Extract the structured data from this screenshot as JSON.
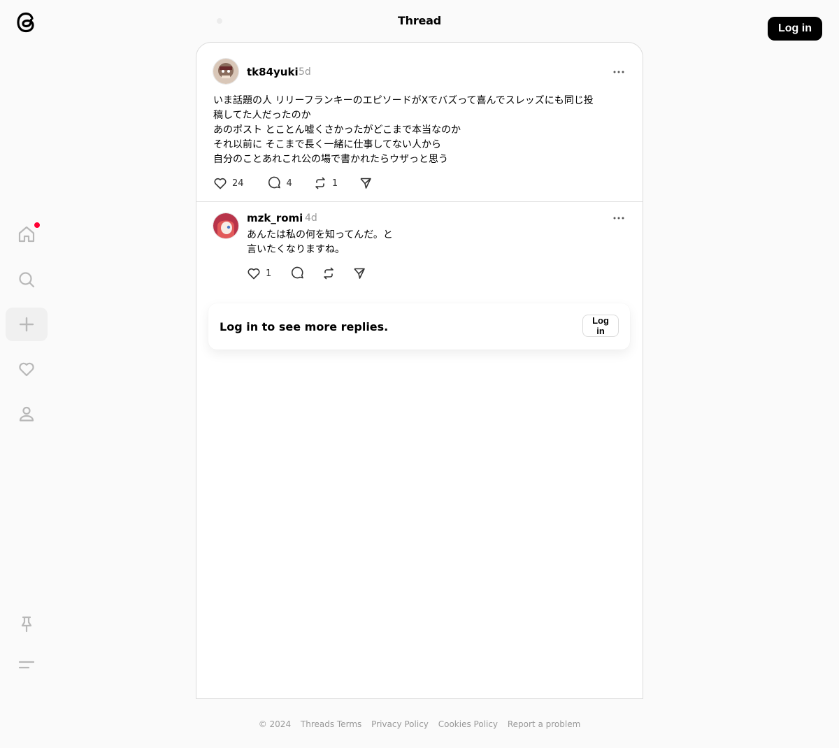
{
  "header": {
    "title": "Thread",
    "login_label": "Log in"
  },
  "sidebar": {
    "items": [
      {
        "name": "home",
        "icon": "home-icon",
        "notification": true
      },
      {
        "name": "search",
        "icon": "search-icon"
      },
      {
        "name": "create",
        "icon": "plus-icon",
        "active": true
      },
      {
        "name": "activity",
        "icon": "heart-icon"
      },
      {
        "name": "profile",
        "icon": "person-icon"
      }
    ],
    "bottom_items": [
      {
        "name": "pinned",
        "icon": "pin-icon"
      },
      {
        "name": "more",
        "icon": "menu-icon"
      }
    ]
  },
  "posts": [
    {
      "username": "tk84yuki",
      "time": "5d",
      "text": "いま話題の人 リリーフランキーのエピソードがXでバズって喜んでスレッズにも同じ投\n稿してた人だったのか\nあのポスト とことん嘘くさかったがどこまで本当なのか\nそれ以前に そこまで長く一緒に仕事してない人から\n自分のことあれこれ公の場で書かれたらウザっと思う",
      "likes": "24",
      "replies": "4",
      "reposts": "1"
    },
    {
      "username": "mzk_romi",
      "time": "4d",
      "text": "あんたは私の何を知ってんだ。と\n言いたくなりますね。",
      "likes": "1",
      "replies": "",
      "reposts": ""
    }
  ],
  "login_banner": {
    "text": "Log in to see more replies.",
    "button": "Log in"
  },
  "footer": {
    "copyright": "© 2024",
    "links": [
      "Threads Terms",
      "Privacy Policy",
      "Cookies Policy",
      "Report a problem"
    ]
  },
  "colors": {
    "accent": "#000000",
    "notification": "#ff0034",
    "muted": "#999999"
  }
}
